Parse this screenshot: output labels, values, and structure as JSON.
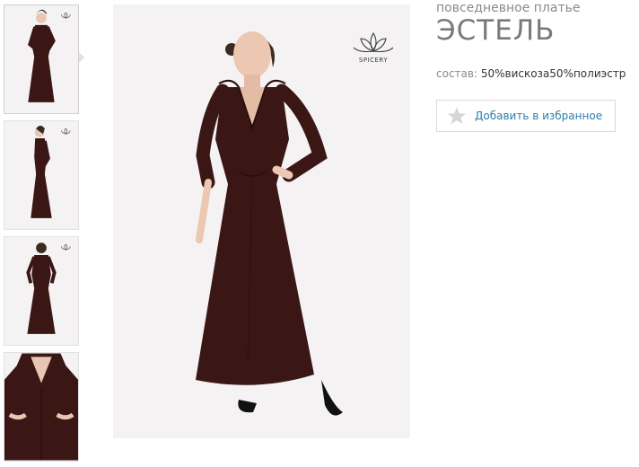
{
  "product": {
    "subtitle": "повседневное платье",
    "title": "ЭСТЕЛЬ",
    "composition_label": "состав:",
    "composition_value": "50%вискоза50%полиэстр"
  },
  "favorite_button": {
    "label": "Добавить в избранное",
    "icon": "star-icon"
  },
  "brand": {
    "logo_text": "SPICERY"
  },
  "thumbnails": [
    {
      "view": "front",
      "active": true
    },
    {
      "view": "side"
    },
    {
      "view": "back"
    },
    {
      "view": "detail"
    }
  ],
  "colors": {
    "dress": "#3a1614",
    "photo_bg": "#f4f2f2",
    "link": "#2b7fae",
    "star": "#d8d5d5"
  }
}
